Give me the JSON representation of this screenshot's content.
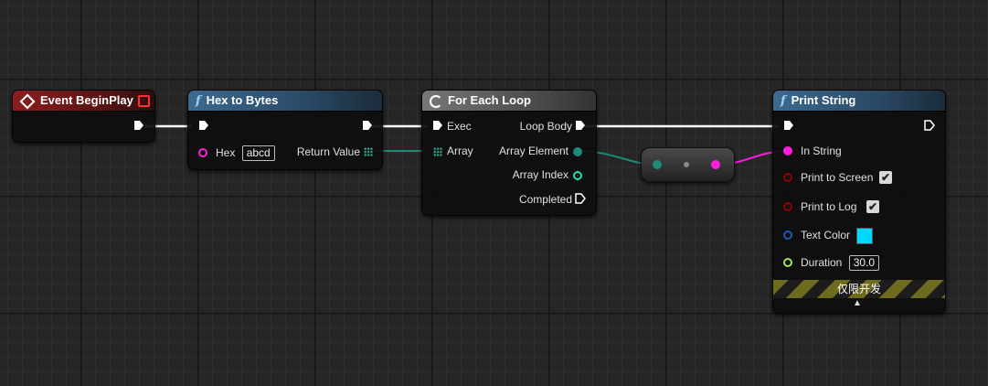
{
  "nodes": {
    "event_begin_play": {
      "title": "Event BeginPlay"
    },
    "hex_to_bytes": {
      "title": "Hex to Bytes",
      "hex_label": "Hex",
      "hex_value": "abcd",
      "return_label": "Return Value"
    },
    "for_each_loop": {
      "title": "For Each Loop",
      "exec_label": "Exec",
      "array_label": "Array",
      "loop_body_label": "Loop Body",
      "array_element_label": "Array Element",
      "array_index_label": "Array Index",
      "completed_label": "Completed"
    },
    "print_string": {
      "title": "Print String",
      "in_string_label": "In String",
      "print_screen_label": "Print to Screen",
      "print_log_label": "Print to Log",
      "text_color_label": "Text Color",
      "duration_label": "Duration",
      "duration_value": "30.0",
      "dev_only_label": "仅限开发",
      "print_screen_checked": true,
      "print_log_checked": true
    }
  },
  "icons": {
    "function": "function-f-icon",
    "event": "event-diamond-icon",
    "loop": "loop-icon",
    "check": "✔",
    "expand": "▲"
  },
  "colors": {
    "exec": "#ffffff",
    "string_pin": "#ff1ee0",
    "byte_pin": "#1f8a76",
    "int_pin": "#1fe3af",
    "bool_pin": "#950000",
    "linear_color_pin": "#1e5ab4",
    "float_pin": "#9ee360",
    "text_color_value": "#00d8ff"
  }
}
